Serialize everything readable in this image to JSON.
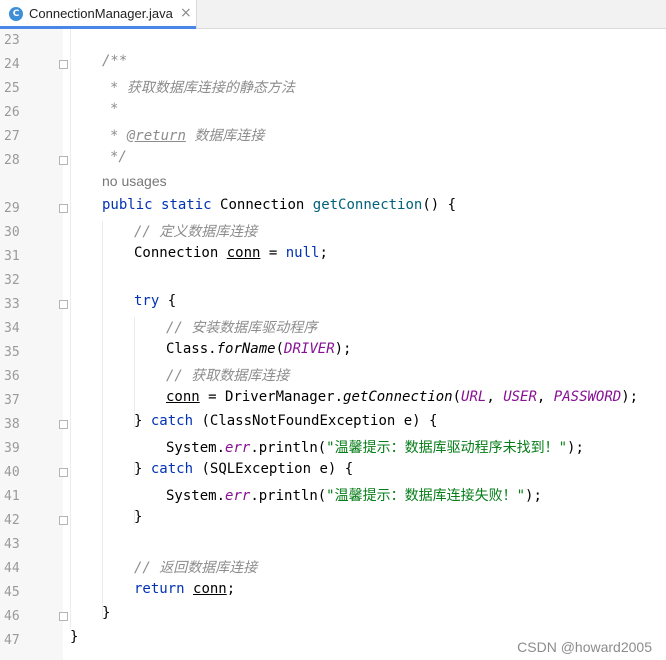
{
  "tab": {
    "icon": "C",
    "title": "ConnectionManager.java",
    "close": "×"
  },
  "watermark": "CSDN @howard2005",
  "lines": [
    {
      "n": "23",
      "text": ""
    },
    {
      "n": "24",
      "text": "/**"
    },
    {
      "n": "25",
      "text": " * 获取数据库连接的静态方法"
    },
    {
      "n": "26",
      "text": " *"
    },
    {
      "n": "27",
      "text": " * @return 数据库连接"
    },
    {
      "n": "28",
      "text": " */"
    },
    {
      "n": "",
      "text": "no usages"
    },
    {
      "n": "29",
      "text": "public static Connection getConnection() {"
    },
    {
      "n": "30",
      "text": "// 定义数据库连接"
    },
    {
      "n": "31",
      "text": "Connection conn = null;"
    },
    {
      "n": "32",
      "text": ""
    },
    {
      "n": "33",
      "text": "try {"
    },
    {
      "n": "34",
      "text": "// 安装数据库驱动程序"
    },
    {
      "n": "35",
      "text": "Class.forName(DRIVER);"
    },
    {
      "n": "36",
      "text": "// 获取数据库连接"
    },
    {
      "n": "37",
      "text": "conn = DriverManager.getConnection(URL, USER, PASSWORD);"
    },
    {
      "n": "38",
      "text": "} catch (ClassNotFoundException e) {"
    },
    {
      "n": "39",
      "text": "System.err.println(\"温馨提示：数据库驱动程序未找到！\");"
    },
    {
      "n": "40",
      "text": "} catch (SQLException e) {"
    },
    {
      "n": "41",
      "text": "System.err.println(\"温馨提示：数据库连接失败！\");"
    },
    {
      "n": "42",
      "text": "}"
    },
    {
      "n": "43",
      "text": ""
    },
    {
      "n": "44",
      "text": "// 返回数据库连接"
    },
    {
      "n": "45",
      "text": "return conn;"
    },
    {
      "n": "46",
      "text": "}"
    },
    {
      "n": "47",
      "text": "}"
    }
  ],
  "tokens": {
    "kw_public": "public",
    "kw_static": "static",
    "kw_null": "null",
    "kw_try": "try",
    "kw_catch": "catch",
    "kw_return": "return",
    "doc_open": "/**",
    "doc_desc": "获取数据库连接的静态方法",
    "doc_star": "*",
    "doc_tag": "@return",
    "doc_tag_desc": "数据库连接",
    "doc_close": "*/",
    "hint_usages": "no usages",
    "type_connection": "Connection",
    "method_getConnection": "getConnection",
    "parens_open": "() {",
    "cmt_define": "// 定义数据库连接",
    "var_conn": "conn",
    "assign": " = ",
    "semicolon": ";",
    "brace_open": " {",
    "cmt_install": "// 安装数据库驱动程序",
    "class_class": "Class",
    "dot": ".",
    "method_forName": "forName",
    "paren_l": "(",
    "field_DRIVER": "DRIVER",
    "paren_r_semicolon": ");",
    "cmt_get": "// 获取数据库连接",
    "class_DriverManager": "DriverManager",
    "field_URL": "URL",
    "comma": ", ",
    "field_USER": "USER",
    "field_PASSWORD": "PASSWORD",
    "brace_close": "}",
    "exc_cnf": " (ClassNotFoundException e) {",
    "system": "System",
    "field_err": "err",
    "println": ".println(",
    "str_driver_missing": "\"温馨提示：数据库驱动程序未找到！\"",
    "exc_sql": " (SQLException e) {",
    "str_conn_fail": "\"温馨提示：数据库连接失败！\"",
    "cmt_return": "// 返回数据库连接"
  },
  "colors": {
    "keyword": "#0033b3",
    "method_decl": "#00627a",
    "comment": "#8c8c8c",
    "string": "#067d17",
    "static_field": "#871094"
  }
}
